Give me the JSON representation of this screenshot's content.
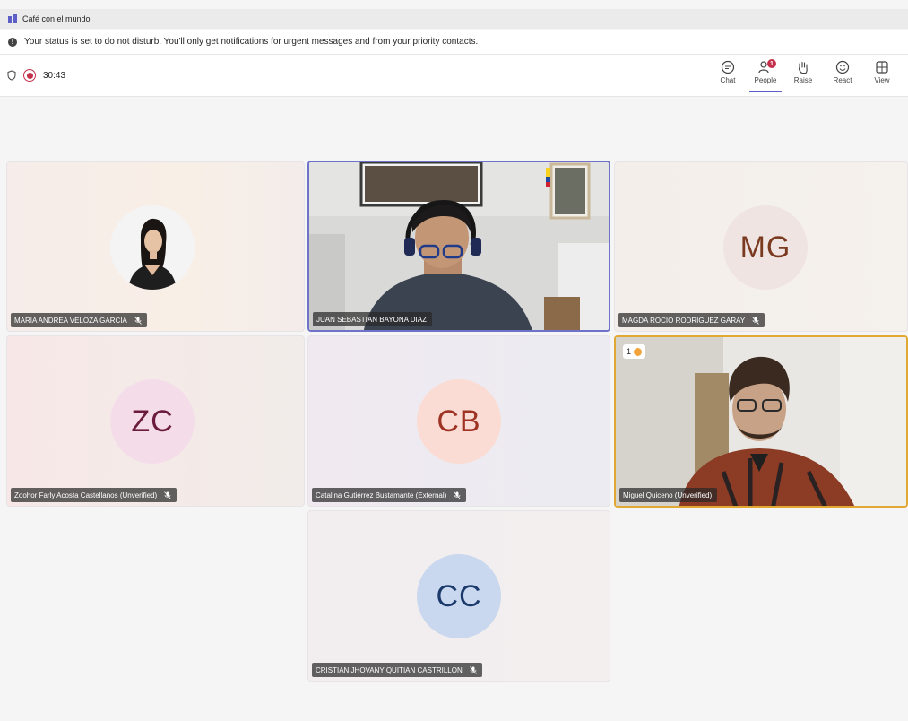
{
  "window": {
    "title": "Café con el mundo"
  },
  "status": {
    "message": "Your status is set to do not disturb. You'll only get notifications for urgent messages and from your priority contacts."
  },
  "toolbar": {
    "timer": "30:43",
    "people_badge": "1",
    "items": [
      {
        "label": "Chat",
        "icon": "chat-icon"
      },
      {
        "label": "People",
        "icon": "people-icon"
      },
      {
        "label": "Raise",
        "icon": "raise-hand-icon"
      },
      {
        "label": "React",
        "icon": "react-icon"
      },
      {
        "label": "View",
        "icon": "view-icon"
      }
    ]
  },
  "participants": [
    {
      "name": "MARIA ANDREA VELOZA GARCIA",
      "type": "photo",
      "muted": true
    },
    {
      "name": "JUAN SEBASTIAN BAYONA DIAZ",
      "type": "video",
      "muted": false,
      "speaking": true
    },
    {
      "name": "MAGDA ROCIO RODRIGUEZ GARAY",
      "initials": "MG",
      "type": "initials",
      "muted": true,
      "avatar_bg": "#efe4e1",
      "initials_color": "#7a3a1f"
    },
    {
      "name": "Zoohor Farly Acosta Castellanos (Unverified)",
      "initials": "ZC",
      "type": "initials",
      "muted": true,
      "avatar_bg": "#f4dde8",
      "initials_color": "#6b1b3d"
    },
    {
      "name": "Catalina Gutiérrez Bustamante (External)",
      "initials": "CB",
      "type": "initials",
      "muted": true,
      "avatar_bg": "#fadcd4",
      "initials_color": "#9e3223"
    },
    {
      "name": "Miguel Quiceno (Unverified)",
      "type": "video",
      "muted": false,
      "raised_hand": "1"
    },
    {
      "name": "CRISTIAN JHOVANY QUITIAN CASTRILLON",
      "initials": "CC",
      "type": "initials",
      "muted": true,
      "avatar_bg": "#c9d8ee",
      "initials_color": "#1b3a6b"
    }
  ],
  "colors": {
    "accent": "#5b5fc7",
    "record": "#c4314b",
    "raise_border": "#e2a834"
  }
}
